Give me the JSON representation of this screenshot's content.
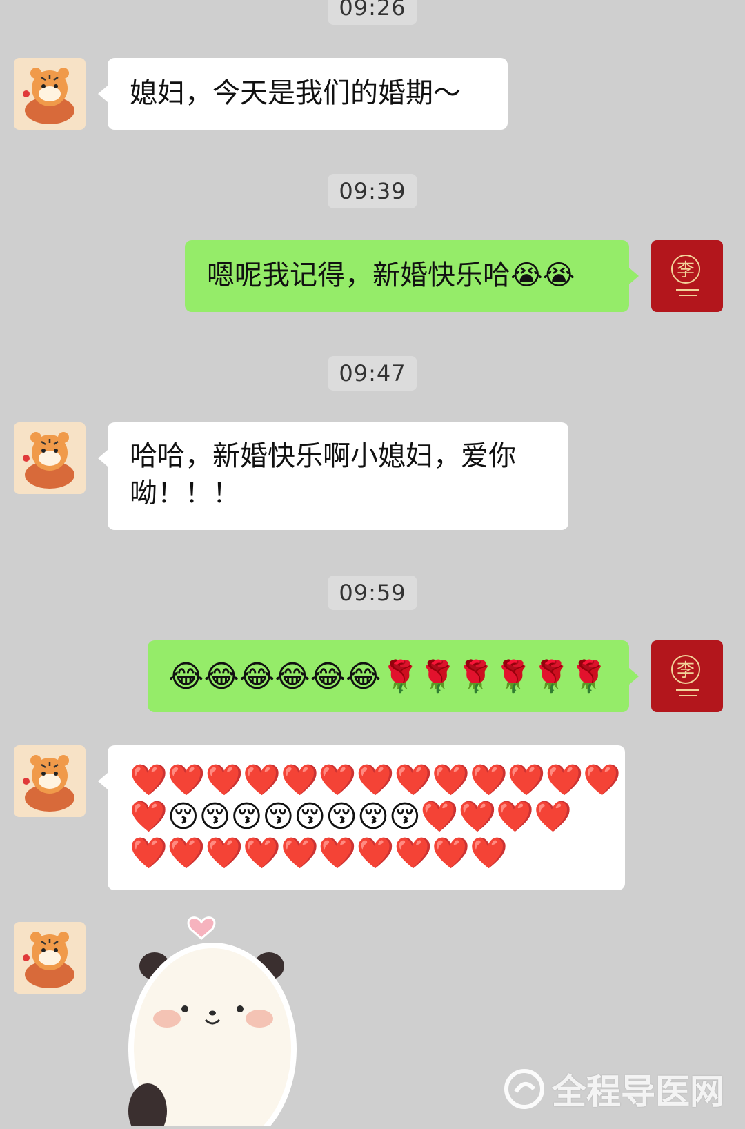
{
  "timestamps": [
    "09:26",
    "09:39",
    "09:47",
    "09:59"
  ],
  "messages": {
    "m1": "媳妇，今天是我们的婚期～",
    "m2": "嗯呢我记得，新婚快乐哈😭😭",
    "m3_line1": "哈哈，新婚快乐啊小媳妇，爱你",
    "m3_line2": "呦！！！",
    "m4": "😂😂😂😂😂😂🌹🌹🌹🌹🌹🌹",
    "m5_row1": "❤️❤️❤️❤️❤️❤️❤️❤️❤️❤️❤️❤️❤️",
    "m5_row2": "❤️😚😚😚😚😚😚😚😚❤️❤️❤️❤️",
    "m5_row3": "❤️❤️❤️❤️❤️❤️❤️❤️❤️❤️"
  },
  "avatars": {
    "left": "tiger-with-fish-avatar",
    "right": "red-seal-avatar",
    "right_glyph": "李"
  },
  "sticker": "panda-sticker-with-heart",
  "watermark": "全程导医网",
  "colors": {
    "background": "#cfcfcf",
    "incoming_bubble": "#ffffff",
    "outgoing_bubble": "#95ec69",
    "seal_red": "#b3161c"
  }
}
